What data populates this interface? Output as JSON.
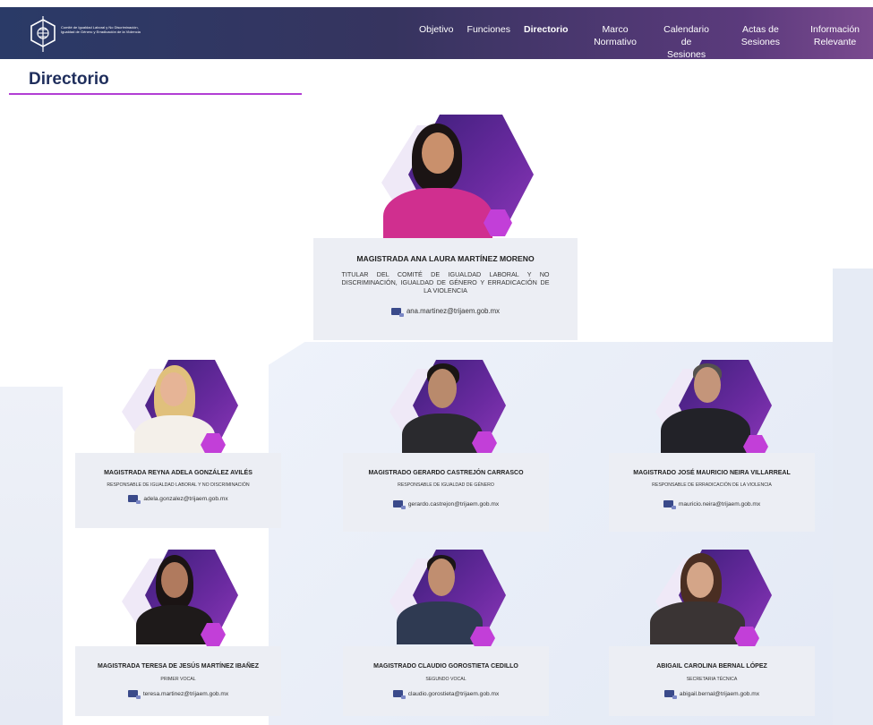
{
  "header": {
    "logo_text": "Comité de Igualdad Laboral y No Discriminación, Igualdad de Género y Erradicación de la Violencia",
    "nav": [
      {
        "label": "Objetivo",
        "active": false
      },
      {
        "label": "Funciones",
        "active": false
      },
      {
        "label": "Directorio",
        "active": true
      },
      {
        "label": "Marco Normativo",
        "active": false
      },
      {
        "label_line1": "Calendario",
        "label_line2": "de Sesiones",
        "active": false
      },
      {
        "label": "Actas de Sesiones",
        "active": false
      },
      {
        "label_line1": "Información",
        "label_line2": "Relevante",
        "active": false
      }
    ]
  },
  "page": {
    "title": "Directorio"
  },
  "accent_color": "#b23fd4",
  "directory": [
    {
      "name": "MAGISTRADA ANA LAURA MARTÍNEZ MORENO",
      "role": "TITULAR DEL COMITÉ DE IGUALDAD LABORAL Y NO DISCRIMINACIÓN, IGUALDAD DE GÉNERO Y ERRADICACIÓN DE LA VIOLENCIA",
      "email": "ana.martinez@trijaem.gob.mx"
    },
    {
      "name": "MAGISTRADA REYNA ADELA GONZÁLEZ AVILÉS",
      "role": "RESPONSABLE DE IGUALDAD LABORAL Y NO DISCRIMINACIÓN",
      "email": "adela.gonzalez@trijaem.gob.mx"
    },
    {
      "name": "MAGISTRADO GERARDO CASTREJÓN CARRASCO",
      "role": "RESPONSABLE DE IGUALDAD DE GÉNERO",
      "email": "gerardo.castrejon@trijaem.gob.mx"
    },
    {
      "name": "MAGISTRADO JOSÉ MAURICIO NEIRA VILLARREAL",
      "role": "RESPONSABLE DE ERRADICACIÓN DE LA VIOLENCIA",
      "email": "mauricio.neira@trijaem.gob.mx"
    },
    {
      "name": "MAGISTRADA TERESA DE JESÚS MARTÍNEZ IBAÑEZ",
      "role": "PRIMER VOCAL",
      "email": "teresa.martinez@trijaem.gob.mx"
    },
    {
      "name": "MAGISTRADO CLAUDIO GOROSTIETA CEDILLO",
      "role": "SEGUNDO VOCAL",
      "email": "claudio.gorostieta@trijaem.gob.mx"
    },
    {
      "name": "ABIGAIL CAROLINA BERNAL LÓPEZ",
      "role": "SECRETARIA TÉCNICA",
      "email": "abigail.bernal@trijaem.gob.mx"
    }
  ]
}
